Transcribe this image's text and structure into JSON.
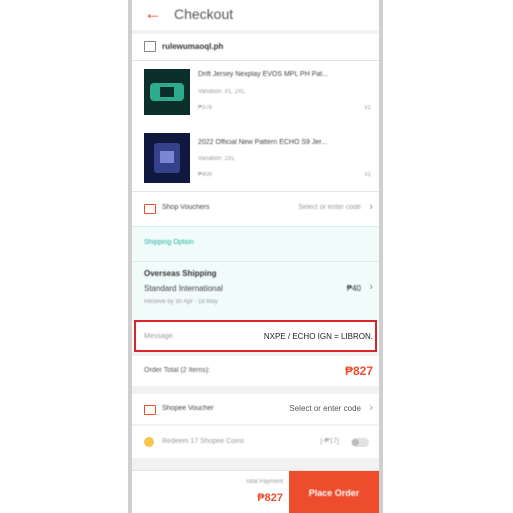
{
  "header": {
    "title": "Checkout"
  },
  "shop": {
    "name": "rulewumaoql.ph"
  },
  "items": [
    {
      "title": "Drift Jersey Nexplay EVOS MPL PH Pat...",
      "variation": "Variation: #1, 2XL",
      "price": "₱378",
      "qty": "x1"
    },
    {
      "title": "2022 Official New Pattern ECHO S9 Jer...",
      "variation": "Variation: 2XL",
      "price": "₱409",
      "qty": "x1"
    }
  ],
  "shop_vouchers": {
    "label": "Shop Vouchers",
    "value": "Select or enter code"
  },
  "shipping": {
    "section_label": "Shipping Option",
    "type": "Overseas Shipping",
    "method": "Standard International",
    "price": "₱40",
    "eta": "Receive by 30 Apr - 18 May"
  },
  "message": {
    "label": "Message:",
    "value": "NXPE / ECHO IGN = LIBRON."
  },
  "order_total": {
    "label": "Order Total (2 Items):",
    "value": "₱827"
  },
  "shopee_voucher": {
    "label": "Shopee Voucher",
    "value": "Select or enter code"
  },
  "coins": {
    "label": "Redeem 17 Shopee Coins",
    "value": "[-₱17]"
  },
  "footer": {
    "total_label": "Total Payment",
    "total_value": "₱827",
    "place_order": "Place Order"
  },
  "colors": {
    "accent": "#ee4d2d",
    "highlight": "#d9262e",
    "shipping_bg": "#f1fbfa",
    "shipping_text": "#27b4a7"
  }
}
